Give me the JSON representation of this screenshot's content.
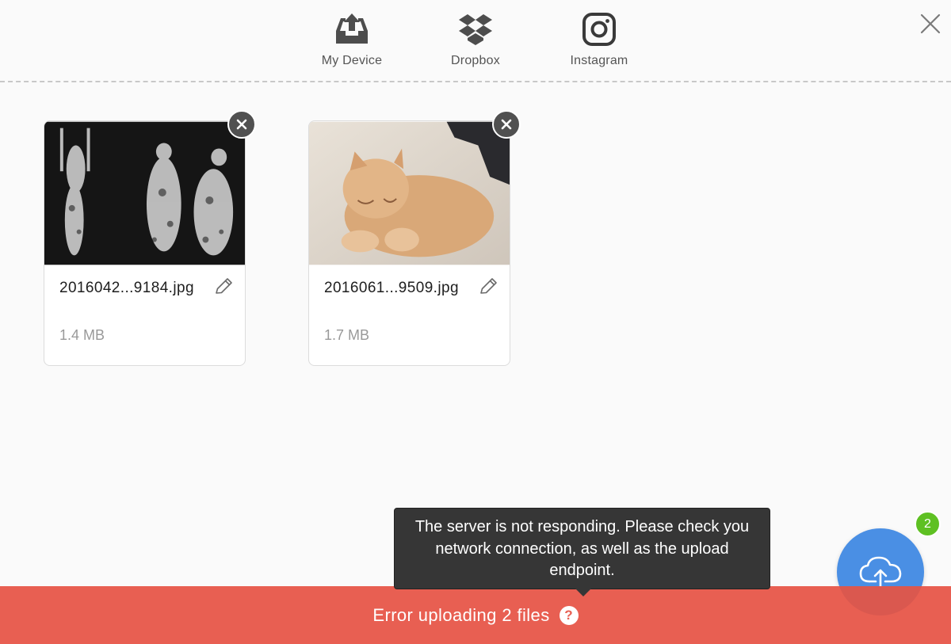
{
  "sources": [
    {
      "label": "My Device",
      "icon": "inbox-upload-icon"
    },
    {
      "label": "Dropbox",
      "icon": "dropbox-icon"
    },
    {
      "label": "Instagram",
      "icon": "instagram-icon"
    }
  ],
  "close_icon": "close-icon",
  "files": [
    {
      "name": "2016042...9184.jpg",
      "size": "1.4 MB"
    },
    {
      "name": "2016061...9509.jpg",
      "size": "1.7 MB"
    }
  ],
  "error": {
    "message": "Error uploading 2 files",
    "help_glyph": "?",
    "tooltip": "The server is not responding. Please check you network connection, as well as the upload endpoint."
  },
  "upload": {
    "count": "2",
    "icon": "cloud-upload-icon"
  },
  "colors": {
    "error": "#e85f52",
    "accent": "#4a8fe4",
    "badge": "#5ec022",
    "tooltip": "#363636"
  }
}
